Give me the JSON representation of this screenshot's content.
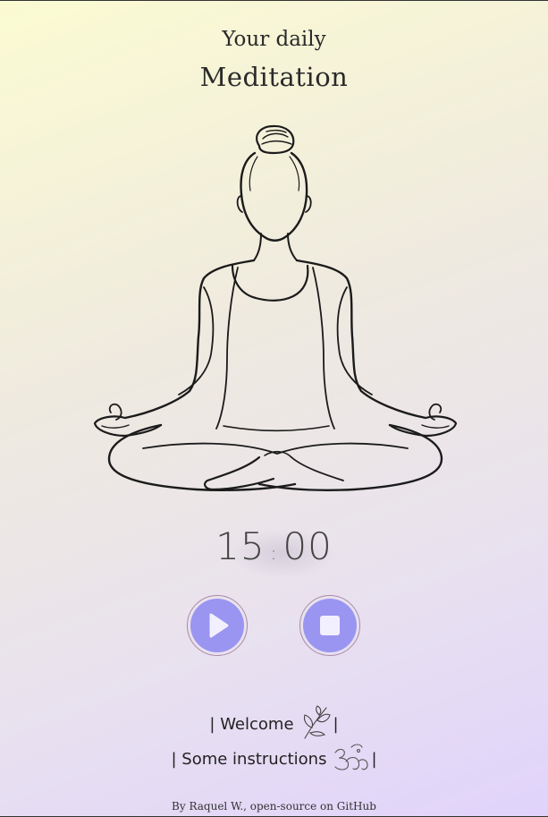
{
  "header": {
    "subtitle": "Your daily",
    "title": "Meditation"
  },
  "timer": {
    "minutes": "15",
    "separator": ":",
    "seconds": "00"
  },
  "controls": {
    "play_icon": "play-icon",
    "stop_icon": "stop-icon",
    "accent": "#9a95f0"
  },
  "links": {
    "welcome": "Welcome",
    "instructions": "Some instructions",
    "welcome_icon": "leaf-icon",
    "instructions_icon": "om-icon"
  },
  "footer": {
    "text": "By Raquel W., open-source on GitHub"
  }
}
